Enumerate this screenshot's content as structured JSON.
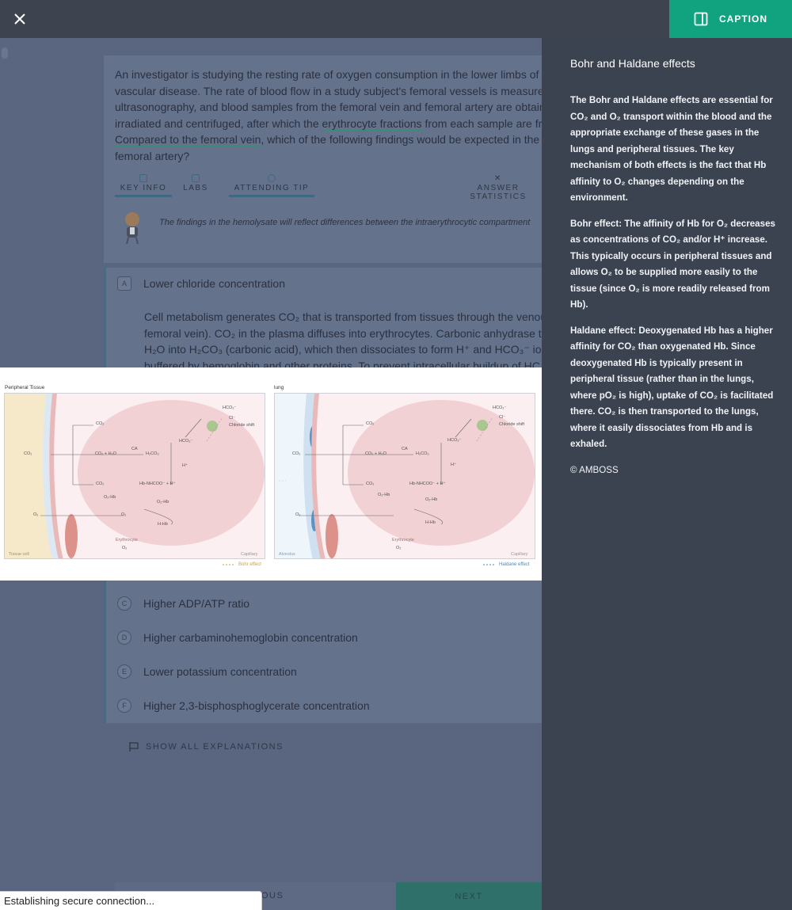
{
  "header": {
    "close_icon": "close-icon",
    "caption_label": "CAPTION",
    "caption_icon": "sidebar-panel-icon",
    "accent_color": "#11a37f"
  },
  "question": {
    "text_line1": "An investigator is studying the resting rate of oxygen consumption in the lower limbs of",
    "text_line2": "vascular disease. The rate of blood flow in a study subject's femoral vessels is measured",
    "text_line3": "ultrasonography, and blood samples from the femoral vein and femoral artery are obtain",
    "text_line4_pre": "irradiated and centrifuged, after which the ",
    "text_line4_link": "erythrocyte fractions",
    "text_line4_post": " from each sample are fr",
    "text_line5_link": "Compared to the femoral vein",
    "text_line5_post": ", which of the following findings would be expected in the",
    "text_line6": "femoral artery?"
  },
  "tabs": [
    {
      "label": "KEY INFO"
    },
    {
      "label": "LABS"
    },
    {
      "label": "ATTENDING TIP"
    },
    {
      "label": "ANSWER STATISTICS"
    }
  ],
  "hint": {
    "text": "The findings in the hemolysate will reflect differences between the intraerythrocytic compartment"
  },
  "answers": [
    {
      "letter": "A",
      "text": "Lower chloride concentration"
    },
    {
      "letter": "C",
      "text": "Higher ADP/ATP ratio"
    },
    {
      "letter": "D",
      "text": "Higher carbaminohemoglobin concentration"
    },
    {
      "letter": "E",
      "text": "Lower potassium concentration"
    },
    {
      "letter": "F",
      "text": "Higher 2,3-bisphosphoglycerate concentration"
    }
  ],
  "explanation": {
    "line1": "Cell metabolism generates CO₂ that is transported from tissues through the venou",
    "line2": "femoral vein). CO₂ in the plasma diffuses into erythrocytes. Carbonic anhydrase tr",
    "line3": "H₂O into H₂CO₃ (carbonic acid), which then dissociates to form H⁺ and HCO₃⁻ ions",
    "line4": "buffered by hemoglobin and other proteins. To prevent intracellular buildup of HC"
  },
  "show_explanations_label": "SHOW ALL EXPLANATIONS",
  "nav": {
    "prev_label": "OUS",
    "next_label": "NEXT"
  },
  "figure": {
    "left_title": "Peripheral Tissue",
    "right_title": "lung",
    "left_labels": {
      "hco3_top": "HCO₃⁻",
      "cl": "Cl⁻",
      "chloride_shift": "Chloride shift",
      "co2_a": "CO₂",
      "hco3_mid": "HCO₃⁻",
      "co2_out": "CO₂",
      "co2_h2o": "CO₂ + H₂O",
      "ca": "CA",
      "h2co3": "H₂CO₃",
      "h_plus": "H⁺",
      "co2_b": "CO₂",
      "hbnhcoo": "Hb-NHCOO⁻ + H⁺",
      "o2hb_a": "O₂-Hb",
      "o2hb_b": "O₂-Hb",
      "o2_out": "O₂",
      "o2_in": "O₂",
      "hhb": "H-Hb",
      "erythrocyte": "Erythrocyte",
      "o2_bottom": "O₂",
      "tissue_cell": "Tissue cell",
      "capillary": "Capillary",
      "legend": "Bohr effect"
    },
    "right_labels": {
      "hco3_top": "HCO₃⁻",
      "cl": "Cl⁻",
      "chloride_shift": "Chloride shift",
      "co2_a": "CO₂",
      "hco3_mid": "HCO₃⁻",
      "co2_out": "CO₂",
      "co2_h2o": "CO₂ + H₂O",
      "ca": "CA",
      "h2co3": "H₂CO₃",
      "h_plus": "H⁺",
      "co2_b": "CO₂",
      "hbnhcoo": "Hb-NHCOO⁻ + H⁺",
      "o2hb_a": "O₂-Hb",
      "o2hb_b": "O₂-Hb",
      "o2_out": "O₂",
      "hhb": "H-Hb",
      "erythrocyte": "Erythrocyte",
      "o2_bottom": "O₂",
      "alveolus": "Alveolus",
      "capillary": "Capillary",
      "legend": "Haldane effect"
    }
  },
  "caption": {
    "title": "Bohr and Haldane effects",
    "p1": "The Bohr and Haldane effects are essential for CO₂ and O₂ transport within the blood and the appropriate exchange of these gases in the lungs and peripheral tissues. The key mechanism of both effects is the fact that Hb affinity to O₂ changes depending on the environment.",
    "p2": "Bohr effect: The affinity of Hb for O₂ decreases as concentrations of CO₂ and/or H⁺ increase. This typically occurs in peripheral tissues and allows O₂ to be supplied more easily to the tissue (since O₂ is more readily released from Hb).",
    "p3": "Haldane effect: Deoxygenated Hb has a higher affinity for CO₂ than oxygenated Hb. Since deoxygenated Hb is typically present in peripheral tissue (rather than in the lungs, where pO₂ is high), uptake of CO₂ is facilitated there. CO₂ is then transported to the lungs, where it easily dissociates from Hb and is exhaled.",
    "copyright": "© AMBOSS"
  },
  "status": {
    "text": "Establishing secure connection..."
  }
}
